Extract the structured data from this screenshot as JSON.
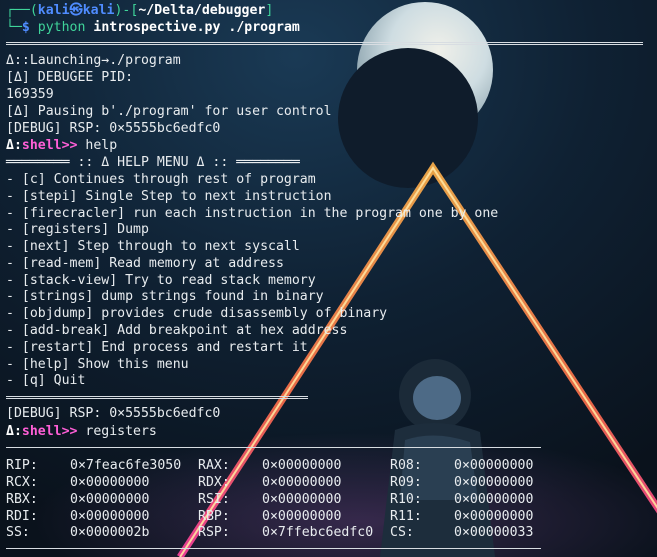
{
  "prompt": {
    "top": "┌──(",
    "user": "kali",
    "at": "㉿",
    "host": "kali",
    "close": ")-[",
    "path": "~/Delta/debugger",
    "end": "]",
    "bottom": "└─",
    "dollar": "$ ",
    "cmd": "python",
    "arg1": "introspective.py",
    "arg2": "./program"
  },
  "session": {
    "launching": "Δ::Launching→./program",
    "pid_label": "[Δ] DEBUGEE PID:",
    "pid": "169359",
    "pausing": "[Δ] Pausing b'./program' for user control",
    "rsp1": "[DEBUG] RSP: 0×5555bc6edfc0",
    "shell_prefix": "Δ:",
    "shell_name": "shell>>",
    "cmd_help": " help",
    "help_header": "════════ :: Δ HELP MENU Δ :: ════════",
    "rsp2": "[DEBUG] RSP: 0×5555bc6edfc0",
    "cmd_registers": " registers"
  },
  "help_items": [
    "- [c] Continues through rest of program",
    "- [stepi] Single Step to next instruction",
    "- [firecracler] run each instruction in the program one by one",
    "- [registers] Dump",
    "- [next] Step through to next syscall",
    "- [read-mem] Read memory at address",
    "- [stack-view] Try to read stack memory",
    "- [strings] dump strings found in binary",
    "- [objdump] provides crude disassembly of binary",
    "- [add-break] Add breakpoint at hex address",
    "- [restart] End process and restart it",
    "- [help] Show this menu",
    "- [q] Quit"
  ],
  "registers": [
    [
      {
        "name": "RIP:",
        "value": "0×7feac6fe3050"
      },
      {
        "name": "RAX:",
        "value": "0×00000000"
      },
      {
        "name": "R08:",
        "value": "0×00000000"
      }
    ],
    [
      {
        "name": "RCX:",
        "value": "0×00000000"
      },
      {
        "name": "RDX:",
        "value": "0×00000000"
      },
      {
        "name": "R09:",
        "value": "0×00000000"
      }
    ],
    [
      {
        "name": "RBX:",
        "value": "0×00000000"
      },
      {
        "name": "RSI:",
        "value": "0×00000000"
      },
      {
        "name": "R10:",
        "value": "0×00000000"
      }
    ],
    [
      {
        "name": "RDI:",
        "value": "0×00000000"
      },
      {
        "name": "RBP:",
        "value": "0×00000000"
      },
      {
        "name": "R11:",
        "value": "0×00000000"
      }
    ],
    [
      {
        "name": "SS:",
        "value": "0×0000002b"
      },
      {
        "name": "RSP:",
        "value": "0×7ffebc6edfc0"
      },
      {
        "name": "CS:",
        "value": "0×00000033"
      }
    ]
  ],
  "colors": {
    "prompt_green": "#3fd49a",
    "prompt_blue": "#4f8cff",
    "shell_magenta": "#ff5fd7",
    "text": "#e8ecef"
  }
}
